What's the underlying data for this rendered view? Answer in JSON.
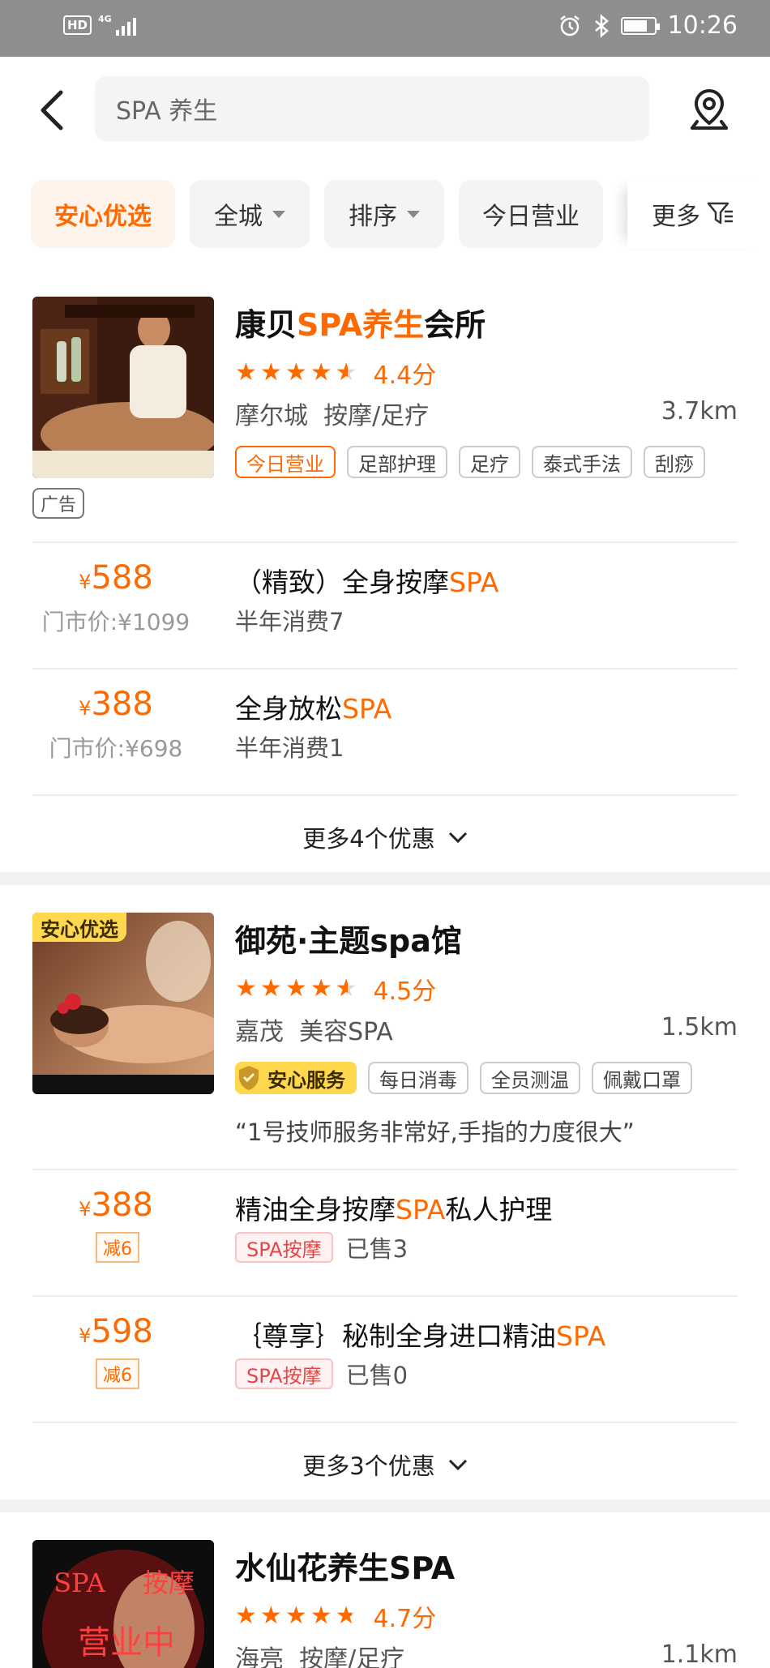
{
  "status_bar": {
    "time": "10:26",
    "hd": "HD",
    "network": "4G"
  },
  "search": {
    "query": "SPA 养生"
  },
  "filters": {
    "items": [
      {
        "label": "安心优选"
      },
      {
        "label": "全城"
      },
      {
        "label": "排序"
      },
      {
        "label": "今日营业"
      }
    ],
    "more_label": "更多"
  },
  "shops": [
    {
      "name_parts": [
        "康贝",
        "SPA养生",
        "会所"
      ],
      "score": "4.4分",
      "rating": 4.4,
      "area": "摩尔城",
      "category": "按摩/足疗",
      "distance": "3.7km",
      "tags": [
        "今日营业",
        "足部护理",
        "足疗",
        "泰式手法",
        "刮痧"
      ],
      "ad_label": "广告",
      "deals": [
        {
          "yen": "¥",
          "price": "588",
          "orig": "门市价:¥1099",
          "title_parts": [
            "（精致）全身按摩",
            "SPA"
          ],
          "sub": "半年消费7"
        },
        {
          "yen": "¥",
          "price": "388",
          "orig": "门市价:¥698",
          "title_parts": [
            "全身放松",
            "SPA"
          ],
          "sub": "半年消费1"
        }
      ],
      "more_deals": "更多4个优惠"
    },
    {
      "name_parts": [
        "御苑·主题spa馆"
      ],
      "badge": "安心优选",
      "score": "4.5分",
      "rating": 4.5,
      "area": "嘉茂",
      "category": "美容SPA",
      "distance": "1.5km",
      "guarantee": "安心服务",
      "tags": [
        "每日消毒",
        "全员测温",
        "佩戴口罩"
      ],
      "quote": "“1号技师服务非常好,手指的力度很大”",
      "deals": [
        {
          "yen": "¥",
          "price": "388",
          "cut": "减6",
          "title_parts": [
            "精油全身按摩",
            "SPA",
            "私人护理"
          ],
          "cat": "SPA按摩",
          "sold": "已售3"
        },
        {
          "yen": "¥",
          "price": "598",
          "cut": "减6",
          "title_parts": [
            "｛尊享｝秘制全身进口精油",
            "SPA"
          ],
          "cat": "SPA按摩",
          "sold": "已售0"
        }
      ],
      "more_deals": "更多3个优惠"
    },
    {
      "name_parts": [
        "水仙花养生SPA"
      ],
      "score": "4.7分",
      "rating": 4.7,
      "area": "海亮",
      "category": "按摩/足疗",
      "distance": "1.1km",
      "image_text": [
        "SPA",
        "按摩",
        "营业中"
      ]
    }
  ],
  "colors": {
    "accent": "#ff6a00",
    "status_bar": "#8e8e8e"
  }
}
